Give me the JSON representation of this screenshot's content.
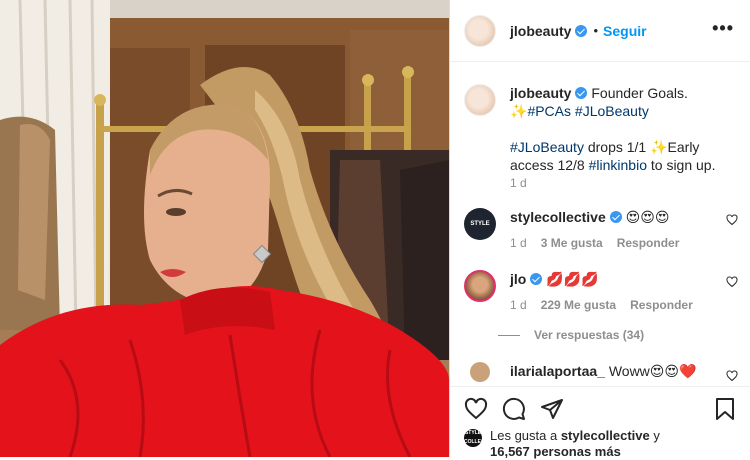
{
  "header": {
    "username": "jlobeauty",
    "separator": "•",
    "follow_label": "Seguir",
    "more_label": "•••"
  },
  "caption": {
    "username": "jlobeauty",
    "text_1": "Founder Goals. ✨",
    "tag_1": "#PCAs",
    "tag_2": "#JLoBeauty",
    "tag_3": "#JLoBeauty",
    "text_2": " drops 1/1 ✨Early access 12/8 ",
    "tag_4": "#linkinbio",
    "text_3": " to sign up.",
    "time": "1 d"
  },
  "comments": [
    {
      "username": "stylecollective",
      "text": "😍😍😍",
      "time": "1 d",
      "likes": "3 Me gusta",
      "reply": "Responder",
      "avatar_text": "STYLE"
    },
    {
      "username": "jlo",
      "text": "💋💋💋",
      "time": "1 d",
      "likes": "229 Me gusta",
      "reply": "Responder"
    },
    {
      "username": "ilarialaportaa_",
      "text": "Woww😍😍❤️"
    }
  ],
  "view_replies": "Ver respuestas (34)",
  "likes": {
    "prefix": "Les gusta a ",
    "user": "stylecollective",
    "mid": " y",
    "count": "16,567 personas más",
    "avatar_text": "STYLE COLLECTIVE"
  },
  "icons": {
    "like": "heart-icon",
    "comment": "comment-icon",
    "share": "paper-plane-icon",
    "save": "bookmark-icon"
  },
  "colors": {
    "link": "#0095f6",
    "hashtag": "#00376b",
    "verified": "#3897f0",
    "meta": "#8e8e8e",
    "dress": "#e3121b"
  }
}
